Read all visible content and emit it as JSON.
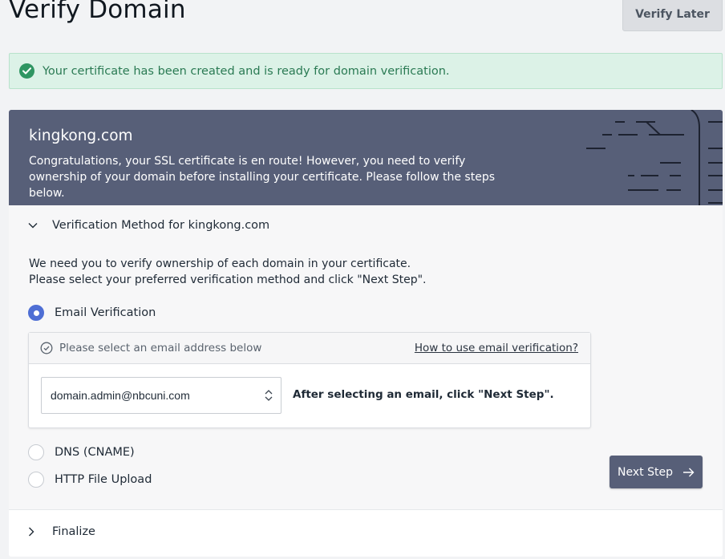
{
  "page": {
    "title": "Verify Domain",
    "verify_later_label": "Verify Later"
  },
  "alert": {
    "message": "Your certificate has been created and is ready for domain verification.",
    "icon": "check-circle-icon"
  },
  "banner": {
    "domain": "kingkong.com",
    "description": "Congratulations, your SSL certificate is en route! However, you need to verify ownership of your domain before installing your certificate. Please follow the steps below."
  },
  "verification": {
    "header": "Verification Method for kingkong.com",
    "instruction_line1": "We need you to verify ownership of each domain in your certificate.",
    "instruction_line2": "Please select your preferred verification method and click \"Next Step\".",
    "methods": [
      {
        "label": "Email Verification",
        "selected": true
      },
      {
        "label": "DNS (CNAME)",
        "selected": false
      },
      {
        "label": "HTTP File Upload",
        "selected": false
      }
    ],
    "email_panel": {
      "hint": "Please select an email address below",
      "help_link": "How to use email verification?",
      "selected_email": "domain.admin@nbcuni.com",
      "after_select_text": "After selecting an email, click \"Next Step\"."
    },
    "next_step_label": "Next Step"
  },
  "finalize": {
    "label": "Finalize"
  },
  "colors": {
    "banner": "#575f78",
    "success_bg": "#dcf2e7",
    "success_text": "#2a7a53",
    "radio_selected": "#4e6ed4"
  }
}
